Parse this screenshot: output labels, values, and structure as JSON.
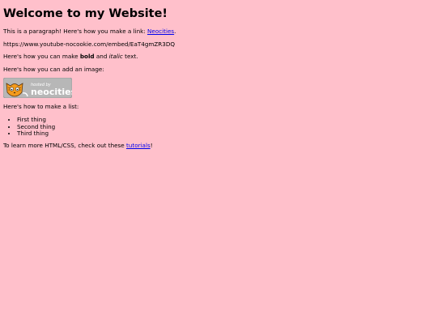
{
  "page": {
    "heading": "Welcome to my Website!",
    "intro_before_link": "This is a paragraph! Here's how you make a link: ",
    "intro_link": "Neocities",
    "intro_after_link": ".",
    "embed_url": "https://www.youtube-nocookie.com/embed/EaT4gmZR3DQ",
    "emphasis_before": "Here's how you can make ",
    "emphasis_bold": "bold",
    "emphasis_middle": " and ",
    "emphasis_italic": "italic",
    "emphasis_after": " text.",
    "image_intro": "Here's how you can add an image:",
    "badge_text": {
      "line1": "hosted by",
      "line2": "neocities"
    },
    "list_intro": "Here's how to make a list:",
    "list_items": [
      "First thing",
      "Second thing",
      "Third thing"
    ],
    "outro_before_link": "To learn more HTML/CSS, check out these ",
    "outro_link": "tutorials",
    "outro_after_link": "!"
  },
  "colors": {
    "background": "#ffc0cb",
    "link": "#0000ee",
    "badge_bg": "#b7b7b7",
    "badge_text": "#ffffff",
    "cat_orange": "#f39a1d"
  }
}
